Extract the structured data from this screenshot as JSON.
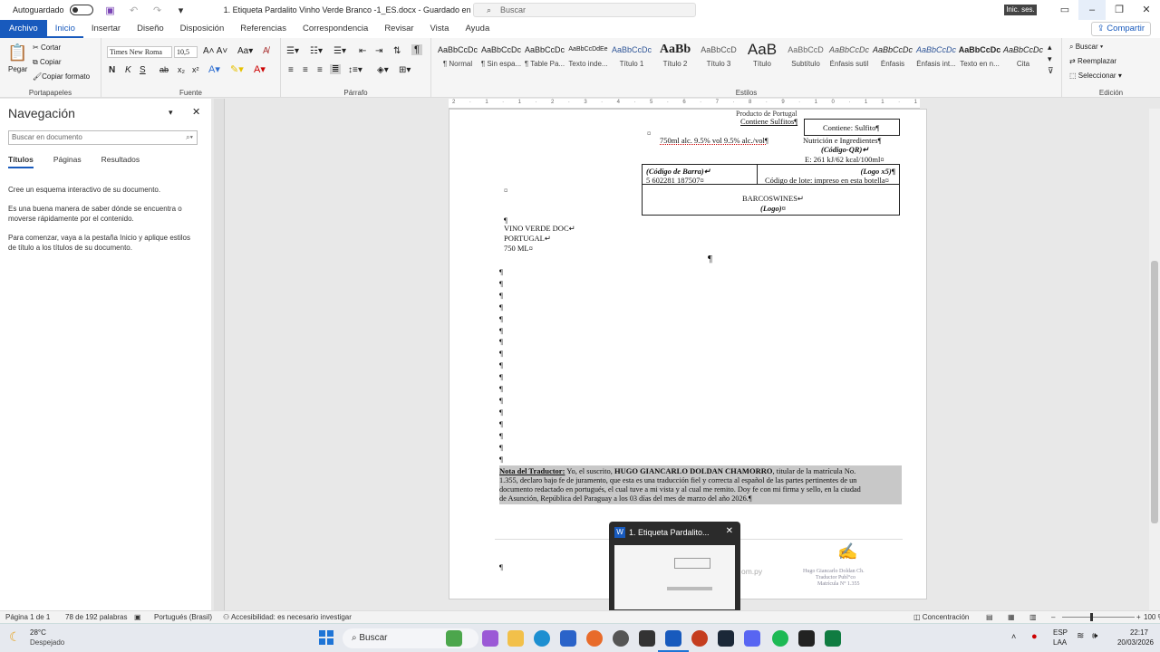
{
  "titlebar": {
    "autosave_label": "Autoguardado",
    "doc_title": "1. Etiqueta Pardalito Vinho Verde Branco -1_ES.docx  -  Guardado en Este PC",
    "search_placeholder": "Buscar",
    "signin_label": "Inic. ses."
  },
  "menu": {
    "file": "Archivo",
    "items": [
      "Inicio",
      "Insertar",
      "Diseño",
      "Disposición",
      "Referencias",
      "Correspondencia",
      "Revisar",
      "Vista",
      "Ayuda"
    ],
    "share": "Compartir"
  },
  "ribbon": {
    "clipboard": {
      "paste": "Pegar",
      "cut": "Cortar",
      "copy": "Copiar",
      "format_painter": "Copiar formato",
      "label": "Portapapeles"
    },
    "font": {
      "name": "Times New Roma",
      "size": "10,5",
      "label": "Fuente",
      "bold": "N",
      "italic": "K",
      "underline": "S"
    },
    "paragraph": {
      "label": "Párrafo"
    },
    "styles": {
      "label": "Estilos",
      "items": [
        {
          "preview": "AaBbCcDc",
          "name": "¶ Normal"
        },
        {
          "preview": "AaBbCcDc",
          "name": "¶ Sin espa..."
        },
        {
          "preview": "AaBbCcDc",
          "name": "¶ Table Pa..."
        },
        {
          "preview": "AaBbCcDdEe",
          "name": "Texto inde..."
        },
        {
          "preview": "AaBbCcDc",
          "name": "Título 1"
        },
        {
          "preview": "AaBb",
          "name": "Título 2"
        },
        {
          "preview": "AaBbCcD",
          "name": "Título 3"
        },
        {
          "preview": "AaB",
          "name": "Título"
        },
        {
          "preview": "AaBbCcD",
          "name": "Subtítulo"
        },
        {
          "preview": "AaBbCcDc",
          "name": "Énfasis sutil"
        },
        {
          "preview": "AaBbCcDc",
          "name": "Énfasis"
        },
        {
          "preview": "AaBbCcDc",
          "name": "Énfasis int..."
        },
        {
          "preview": "AaBbCcDc",
          "name": "Texto en n..."
        },
        {
          "preview": "AaBbCcDc",
          "name": "Cita"
        }
      ]
    },
    "editing": {
      "find": "Buscar",
      "replace": "Reemplazar",
      "select": "Seleccionar",
      "label": "Edición"
    }
  },
  "nav": {
    "title": "Navegación",
    "search_placeholder": "Buscar en documento",
    "tabs": [
      "Títulos",
      "Páginas",
      "Resultados"
    ],
    "text1": "Cree un esquema interactivo de su documento.",
    "text2": "Es una buena manera de saber dónde se encuentra o moverse rápidamente por el contenido.",
    "text3": "Para comenzar, vaya a la pestaña Inicio y aplique estilos de título a los títulos de su documento."
  },
  "document": {
    "line_top1": "Producto de Portugal",
    "line_top2": "Contiene Sulfitos¶",
    "contiene": "Contiene: Sulfito¶",
    "vol": "750ml alc. 9.5% vol 9.5% alc./vol¶",
    "nutricion": "Nutrición e Ingredientes¶",
    "codigo_qr": "(Código-QR)↵",
    "energia": "E: 261 kJ/62 kcal/100ml¤",
    "codigo_barra": "(Código de Barra)↵",
    "barcode_num": "5 602281 187507¤",
    "logo_x5": "(Logo x5)¶",
    "lote": "Código de lote: impreso en esta botella¤",
    "barcos": "BARCOSWINES↵",
    "logo": "(Logo)¤",
    "vinho1": "VINO VERDE DOC↵",
    "vinho2": "PORTUGAL↵",
    "vinho3": "750 ML¤",
    "nota_label": "Nota del Traductor:",
    "nota_pre": " Yo, el suscrito, ",
    "nota_name": "HUGO GIANCARLO DOLDAN CHAMORRO",
    "nota_line1_rest": ", titular de la matrícula No.",
    "nota_line2": "1.355, declaro bajo fe de juramento, que esta es una traducción fiel y correcta al español de las partes pertinentes de un",
    "nota_line3": "documento redactado en portugués, el cual tuve a mi vista y al cual me remito. Doy fe con mi firma y sello, en la ciudad",
    "nota_line4": "de Asunción, República del Paraguay a los 03 días del mes de marzo del año 2026.¶",
    "signature1": "Hugo Giancarlo Doldan Ch.",
    "signature2": "Traductor Publ°co",
    "signature3": "Matrícula N° 1.355",
    "web_frag": "om.py"
  },
  "thumbnail": {
    "title": "1. Etiqueta Pardalito..."
  },
  "status": {
    "page": "Página 1 de 1",
    "words": "78 de 192 palabras",
    "lang": "Portugués (Brasil)",
    "access": "Accesibilidad: es necesario investigar",
    "focus": "Concentración",
    "zoom": "100 %"
  },
  "taskbar": {
    "temp": "28°C",
    "weather": "Despejado",
    "search": "Buscar",
    "lang1": "ESP",
    "lang2": "LAA",
    "time": "22:17",
    "date": "20/03/2026"
  }
}
